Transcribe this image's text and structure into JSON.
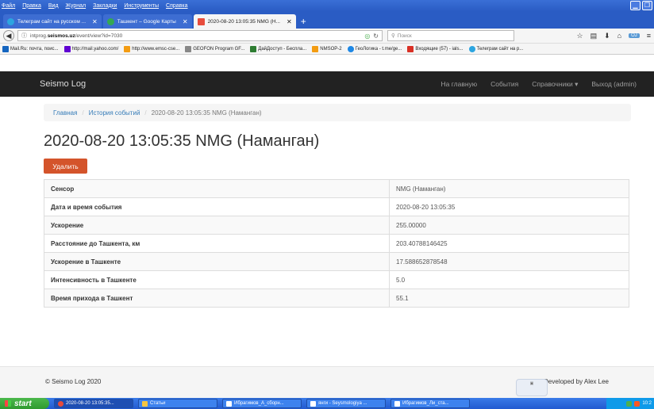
{
  "browser": {
    "menu": [
      "Файл",
      "Правка",
      "Вид",
      "Журнал",
      "Закладки",
      "Инструменты",
      "Справка"
    ],
    "tabs": [
      {
        "label": "Телеграм сайт на русском ...",
        "active": false,
        "icon_color": "#2ca5e0"
      },
      {
        "label": "Ташкент – Google Карты",
        "active": false,
        "icon_color": "#34a853"
      },
      {
        "label": "2020-08-20 13:05:35 NMG (Н...",
        "active": true,
        "icon_color": "#e74c3c"
      }
    ],
    "url_prefix": "intprog.",
    "url_domain": "seismos.uz",
    "url_path": "/event/view?id=7030",
    "search_placeholder": "Поиск",
    "bookmarks": [
      {
        "label": "Mail.Ru: почта, поис...",
        "color": "#1565c0"
      },
      {
        "label": "http://mail.yahoo.com/",
        "color": "#6001d2"
      },
      {
        "label": "http://www.emsc-cse...",
        "color": "#f39c12"
      },
      {
        "label": "GEOFON Program GF...",
        "color": "#888888"
      },
      {
        "label": "ДайДоступ - Беспла...",
        "color": "#2e7d32"
      },
      {
        "label": "NMSOP-2",
        "color": "#f39c12"
      },
      {
        "label": "ГеоЛогика - t.me/ge...",
        "color": "#1e88e5"
      },
      {
        "label": "Входящие (57) - ials...",
        "color": "#d93025"
      },
      {
        "label": "Телеграм сайт на р...",
        "color": "#2ca5e0"
      }
    ]
  },
  "site": {
    "brand": "Seismo Log",
    "nav": [
      "На главную",
      "События",
      "Справочники ▾",
      "Выход (admin)"
    ]
  },
  "breadcrumb": {
    "home": "Главная",
    "history": "История событий",
    "current": "2020-08-20 13:05:35 NMG (Наманган)"
  },
  "page": {
    "title": "2020-08-20 13:05:35 NMG (Наманган)",
    "delete_label": "Удалить"
  },
  "details": [
    {
      "key": "Сенсор",
      "value": "NMG (Наманган)"
    },
    {
      "key": "Дата и время события",
      "value": "2020-08-20 13:05:35"
    },
    {
      "key": "Ускорение",
      "value": "255.00000"
    },
    {
      "key": "Расстояние до Ташкента, км",
      "value": "203.40788146425"
    },
    {
      "key": "Ускорение в Ташкенте",
      "value": "17.588652878548"
    },
    {
      "key": "Интенсивность в Ташкенте",
      "value": "5.0"
    },
    {
      "key": "Время прихода в Ташкент",
      "value": "55.1"
    }
  ],
  "footer": {
    "copyright": "© Seismo Log 2020",
    "developer": "Developed by Alex Lee"
  },
  "taskbar": {
    "start": "start",
    "tasks": [
      {
        "label": "2020-08-20 13:05:35...",
        "active": true,
        "color": "#e74c3c"
      },
      {
        "label": "Статьи",
        "active": false,
        "color": "#f4c542"
      },
      {
        "label": "Ибрагимов_А_сборн...",
        "active": false,
        "color": "#2b579a"
      },
      {
        "label": "янги - Seysmologiya ...",
        "active": false,
        "color": "#2b579a"
      },
      {
        "label": "Ибрагимов_Ли_ста...",
        "active": false,
        "color": "#2b579a"
      }
    ],
    "clock": "10:2"
  }
}
